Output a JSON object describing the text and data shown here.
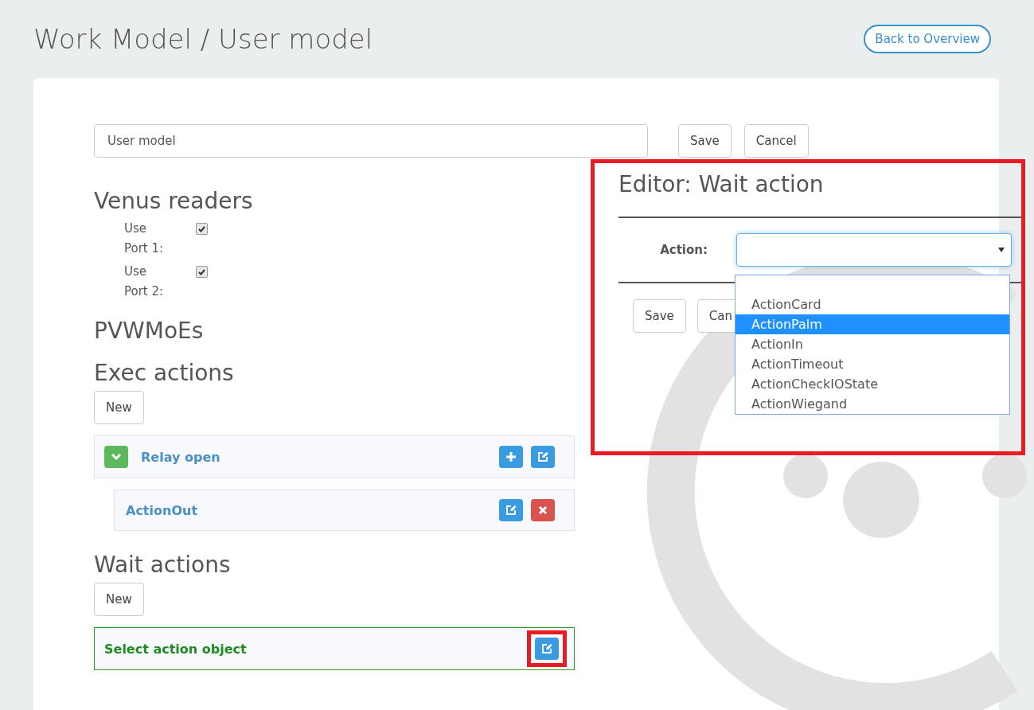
{
  "page": {
    "title": "Work Model / User model",
    "back_button": "Back to Overview"
  },
  "form": {
    "name_value": "User model",
    "save": "Save",
    "cancel": "Cancel"
  },
  "venus_readers": {
    "heading": "Venus readers",
    "ports": [
      {
        "label": "Use Port 1:",
        "checked": true
      },
      {
        "label": "Use Port 2:",
        "checked": true
      }
    ]
  },
  "pvwmoes": {
    "heading": "PVWMoEs"
  },
  "exec_actions": {
    "heading": "Exec actions",
    "new_button": "New",
    "items": [
      {
        "label": "Relay open",
        "expanded": true,
        "buttons": [
          {
            "kind": "add"
          },
          {
            "kind": "edit"
          }
        ],
        "children": [
          {
            "label": "ActionOut",
            "buttons": [
              {
                "kind": "edit"
              },
              {
                "kind": "delete"
              }
            ]
          }
        ]
      }
    ]
  },
  "wait_actions": {
    "heading": "Wait actions",
    "new_button": "New",
    "items": [
      {
        "label": "Select action object",
        "highlighted": true,
        "buttons": [
          {
            "kind": "edit"
          }
        ],
        "annotated": true
      }
    ]
  },
  "editor": {
    "title": "Editor: Wait action",
    "annotated": true,
    "action_label": "Action:",
    "save": "Save",
    "cancel": "Can",
    "dropdown_open": true,
    "options": [
      {
        "label": "ActionCard",
        "selected": false
      },
      {
        "label": "ActionPalm",
        "selected": true
      },
      {
        "label": "ActionIn",
        "selected": false
      },
      {
        "label": "ActionTimeout",
        "selected": false
      },
      {
        "label": "ActionCheckIOState",
        "selected": false
      },
      {
        "label": "ActionWiegand",
        "selected": false
      }
    ]
  }
}
